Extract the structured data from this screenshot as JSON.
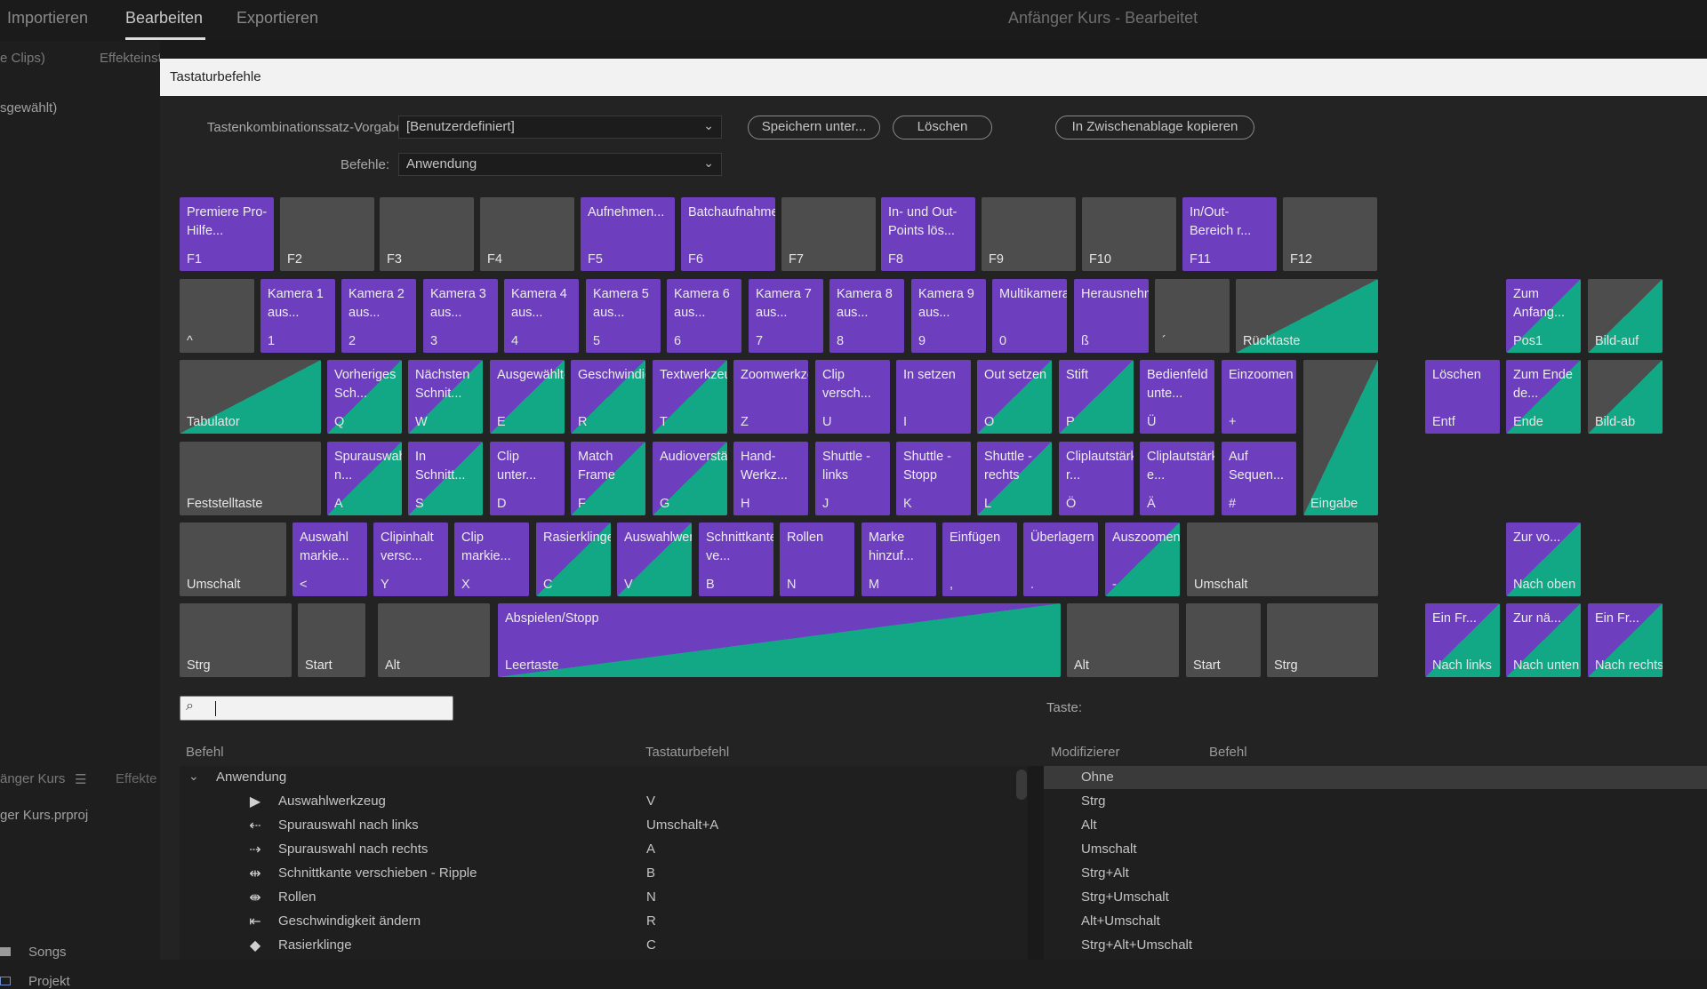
{
  "topbar": {
    "tabs": [
      {
        "label": "Importieren"
      },
      {
        "label": "Bearbeiten"
      },
      {
        "label": "Exportieren"
      }
    ],
    "title": "Anfänger Kurs - Bearbeitet"
  },
  "left_panel": {
    "clips": "e Clips)",
    "effects_tab": "Effekteinstellungen",
    "selected": "sgewählt)",
    "project_tab": "änger Kurs",
    "effects_tab2": "Effekte",
    "project_file": "ger Kurs.prproj",
    "bins": [
      {
        "label": "Songs"
      },
      {
        "label": "Projekt"
      }
    ]
  },
  "dialog": {
    "title": "Tastaturbefehle",
    "preset_label": "Tastenkombinationssatz-Vorgabe:",
    "preset_value": "[Benutzerdefiniert]",
    "commands_label": "Befehle:",
    "commands_value": "Anwendung",
    "buttons": {
      "save_as": "Speichern unter...",
      "delete": "Löschen",
      "copy": "In Zwischenablage kopieren"
    }
  },
  "keyboard": {
    "function_row": [
      {
        "label": "F1",
        "cmd": "Premiere Pro-Hilfe...",
        "style": "purple"
      },
      {
        "label": "F2",
        "cmd": "",
        "style": "gray"
      },
      {
        "label": "F3",
        "cmd": "",
        "style": "gray"
      },
      {
        "label": "F4",
        "cmd": "",
        "style": "gray"
      },
      {
        "label": "F5",
        "cmd": "Aufnehmen...",
        "style": "purple"
      },
      {
        "label": "F6",
        "cmd": "Batchaufnahme...",
        "style": "purple"
      },
      {
        "label": "F7",
        "cmd": "",
        "style": "gray"
      },
      {
        "label": "F8",
        "cmd": "In- und Out-Points lös...",
        "style": "purple"
      },
      {
        "label": "F9",
        "cmd": "",
        "style": "gray"
      },
      {
        "label": "F10",
        "cmd": "",
        "style": "gray"
      },
      {
        "label": "F11",
        "cmd": "In/Out-Bereich r...",
        "style": "purple"
      },
      {
        "label": "F12",
        "cmd": "",
        "style": "gray"
      }
    ],
    "number_row": [
      {
        "label": "^",
        "cmd": "",
        "style": "gray"
      },
      {
        "label": "1",
        "cmd": "Kamera 1 aus...",
        "style": "purple"
      },
      {
        "label": "2",
        "cmd": "Kamera 2 aus...",
        "style": "purple"
      },
      {
        "label": "3",
        "cmd": "Kamera 3 aus...",
        "style": "purple"
      },
      {
        "label": "4",
        "cmd": "Kamera 4 aus...",
        "style": "purple"
      },
      {
        "label": "5",
        "cmd": "Kamera 5 aus...",
        "style": "purple"
      },
      {
        "label": "6",
        "cmd": "Kamera 6 aus...",
        "style": "purple"
      },
      {
        "label": "7",
        "cmd": "Kamera 7 aus...",
        "style": "purple"
      },
      {
        "label": "8",
        "cmd": "Kamera 8 aus...",
        "style": "purple"
      },
      {
        "label": "9",
        "cmd": "Kamera 9 aus...",
        "style": "purple"
      },
      {
        "label": "0",
        "cmd": "Multikamera-...",
        "style": "purple"
      },
      {
        "label": "ß",
        "cmd": "Herausnehmen",
        "style": "purple"
      },
      {
        "label": "´",
        "cmd": "",
        "style": "gray"
      },
      {
        "label": "Rücktaste",
        "cmd": "",
        "style": "split-gt"
      }
    ],
    "qwertz_row": [
      {
        "label": "Tabulator",
        "cmd": "",
        "style": "split-gt"
      },
      {
        "label": "Q",
        "cmd": "Vorheriges Sch...",
        "style": "split-pt"
      },
      {
        "label": "W",
        "cmd": "Nächsten Schnit...",
        "style": "split-pt"
      },
      {
        "label": "E",
        "cmd": "Ausgewählten...",
        "style": "split-pt"
      },
      {
        "label": "R",
        "cmd": "Geschwindigkei...",
        "style": "split-pt"
      },
      {
        "label": "T",
        "cmd": "Textwerkzeug",
        "style": "split-pt"
      },
      {
        "label": "Z",
        "cmd": "Zoomwerkzeug",
        "style": "purple"
      },
      {
        "label": "U",
        "cmd": "Clip versch...",
        "style": "purple"
      },
      {
        "label": "I",
        "cmd": "In setzen",
        "style": "purple"
      },
      {
        "label": "O",
        "cmd": "Out setzen",
        "style": "split-pt"
      },
      {
        "label": "P",
        "cmd": "Stift",
        "style": "split-pt"
      },
      {
        "label": "Ü",
        "cmd": "Bedienfeld unte...",
        "style": "purple"
      },
      {
        "label": "+",
        "cmd": "Einzoomen",
        "style": "purple"
      },
      {
        "label": "Eingabe",
        "cmd": "",
        "style": "split-gt"
      }
    ],
    "home_row": [
      {
        "label": "Feststelltaste",
        "cmd": "",
        "style": "gray"
      },
      {
        "label": "A",
        "cmd": "Spurauswahl n...",
        "style": "split-pt"
      },
      {
        "label": "S",
        "cmd": "In Schnitt...",
        "style": "split-pt"
      },
      {
        "label": "D",
        "cmd": "Clip unter...",
        "style": "purple"
      },
      {
        "label": "F",
        "cmd": "Match Frame",
        "style": "split-pt"
      },
      {
        "label": "G",
        "cmd": "Audioverstärku...",
        "style": "split-pt"
      },
      {
        "label": "H",
        "cmd": "Hand-Werkz...",
        "style": "purple"
      },
      {
        "label": "J",
        "cmd": "Shuttle - links",
        "style": "purple"
      },
      {
        "label": "K",
        "cmd": "Shuttle - Stopp",
        "style": "purple"
      },
      {
        "label": "L",
        "cmd": "Shuttle - rechts",
        "style": "split-pt"
      },
      {
        "label": "Ö",
        "cmd": "Cliplautstärke r...",
        "style": "purple"
      },
      {
        "label": "Ä",
        "cmd": "Cliplautstärke e...",
        "style": "purple"
      },
      {
        "label": "#",
        "cmd": "Auf Sequen...",
        "style": "purple"
      }
    ],
    "shift_row": [
      {
        "label": "Umschalt",
        "cmd": "",
        "style": "gray"
      },
      {
        "label": "<",
        "cmd": "Auswahl markie...",
        "style": "purple"
      },
      {
        "label": "Y",
        "cmd": "Clipinhalt versc...",
        "style": "purple"
      },
      {
        "label": "X",
        "cmd": "Clip markie...",
        "style": "purple"
      },
      {
        "label": "C",
        "cmd": "Rasierklinge",
        "style": "split-pt"
      },
      {
        "label": "V",
        "cmd": "Auswahlwerkz...",
        "style": "split-pt"
      },
      {
        "label": "B",
        "cmd": "Schnittkante ve...",
        "style": "purple"
      },
      {
        "label": "N",
        "cmd": "Rollen",
        "style": "purple"
      },
      {
        "label": "M",
        "cmd": "Marke hinzuf...",
        "style": "purple"
      },
      {
        "label": ",",
        "cmd": "Einfügen",
        "style": "purple"
      },
      {
        "label": ".",
        "cmd": "Überlagern",
        "style": "purple"
      },
      {
        "label": "-",
        "cmd": "Auszoomen",
        "style": "split-pt"
      },
      {
        "label": "Umschalt",
        "cmd": "",
        "style": "gray"
      }
    ],
    "bottom_row": [
      {
        "label": "Strg",
        "cmd": "",
        "style": "gray"
      },
      {
        "label": "Start",
        "cmd": "",
        "style": "gray"
      },
      {
        "label": "Alt",
        "cmd": "",
        "style": "gray"
      },
      {
        "label": "Leertaste",
        "cmd": "Abspielen/Stopp",
        "style": "space"
      },
      {
        "label": "Alt",
        "cmd": "",
        "style": "gray"
      },
      {
        "label": "Start",
        "cmd": "",
        "style": "gray"
      },
      {
        "label": "Strg",
        "cmd": "",
        "style": "gray"
      }
    ],
    "nav_keys": [
      {
        "label": "Pos1",
        "cmd": "Zum Anfang...",
        "style": "split-pt"
      },
      {
        "label": "Bild-auf",
        "cmd": "",
        "style": "split-gt"
      },
      {
        "label": "Entf",
        "cmd": "Löschen",
        "style": "purple"
      },
      {
        "label": "Ende",
        "cmd": "Zum Ende de...",
        "style": "split-pt"
      },
      {
        "label": "Bild-ab",
        "cmd": "",
        "style": "split-gt"
      }
    ],
    "arrow_keys": [
      {
        "label": "Nach oben",
        "cmd": "Zur vo...",
        "style": "split-pt"
      },
      {
        "label": "Nach links",
        "cmd": "Ein Fr...",
        "style": "split-pt"
      },
      {
        "label": "Nach unten",
        "cmd": "Zur nä...",
        "style": "split-pt"
      },
      {
        "label": "Nach rechts",
        "cmd": "Ein Fr...",
        "style": "split-pt"
      }
    ]
  },
  "search": {
    "value": "",
    "placeholder": ""
  },
  "taste_label": "Taste:",
  "list": {
    "headers": {
      "command": "Befehl",
      "shortcut": "Tastaturbefehl"
    },
    "group": "Anwendung",
    "rows": [
      {
        "name": "Auswahlwerkzeug",
        "shortcut": "V",
        "icon": "▶"
      },
      {
        "name": "Spurauswahl nach links",
        "shortcut": "Umschalt+A",
        "icon": "⇠"
      },
      {
        "name": "Spurauswahl nach rechts",
        "shortcut": "A",
        "icon": "⇢"
      },
      {
        "name": "Schnittkante verschieben - Ripple",
        "shortcut": "B",
        "icon": "⇹"
      },
      {
        "name": "Rollen",
        "shortcut": "N",
        "icon": "⇼"
      },
      {
        "name": "Geschwindigkeit ändern",
        "shortcut": "R",
        "icon": "⇤"
      },
      {
        "name": "Rasierklinge",
        "shortcut": "C",
        "icon": "◆"
      }
    ]
  },
  "modifiers": {
    "headers": {
      "modifier": "Modifizierer",
      "command": "Befehl"
    },
    "rows": [
      {
        "name": "Ohne",
        "selected": true
      },
      {
        "name": "Strg"
      },
      {
        "name": "Alt"
      },
      {
        "name": "Umschalt"
      },
      {
        "name": "Strg+Alt"
      },
      {
        "name": "Strg+Umschalt"
      },
      {
        "name": "Alt+Umschalt"
      },
      {
        "name": "Strg+Alt+Umschalt"
      }
    ]
  }
}
